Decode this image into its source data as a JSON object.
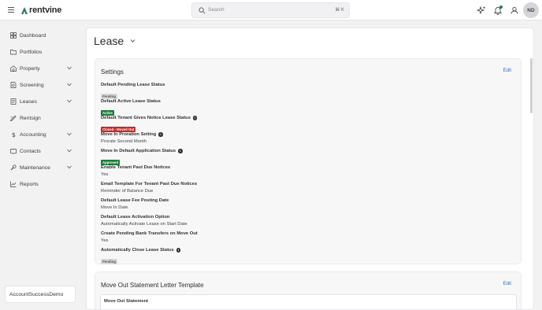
{
  "header": {
    "logo_text": "rentvine",
    "search_placeholder": "Search",
    "search_shortcut": "⌘ K",
    "avatar_initials": "ND",
    "brand_color": "#1f7a63"
  },
  "sidebar": {
    "items": [
      {
        "label": "Dashboard",
        "icon": "dashboard-icon"
      },
      {
        "label": "Portfolios",
        "icon": "folder-icon"
      },
      {
        "label": "Property",
        "icon": "building-icon"
      },
      {
        "label": "Screening",
        "icon": "screening-icon"
      },
      {
        "label": "Leases",
        "icon": "lease-icon"
      },
      {
        "label": "Rentsign",
        "icon": "sign-icon"
      },
      {
        "label": "Accounting",
        "icon": "dollar-icon"
      },
      {
        "label": "Contacts",
        "icon": "contacts-icon"
      },
      {
        "label": "Maintenance",
        "icon": "wrench-icon"
      },
      {
        "label": "Reports",
        "icon": "reports-icon"
      }
    ],
    "account_name": "AccountSuccessDemo"
  },
  "main": {
    "title": "Lease",
    "settings": {
      "title": "Settings",
      "edit_label": "Edit",
      "fields": [
        {
          "label": "Default Pending Lease Status",
          "badge": "Pending",
          "badge_color": "grey"
        },
        {
          "label": "Default Active Lease Status",
          "badge": "Active",
          "badge_color": "green"
        },
        {
          "label": "Default Tenant Gives Notice Lease Status",
          "badge": "Closed - Moved Out",
          "badge_color": "red",
          "info": true
        },
        {
          "label": "Move In Proration Setting",
          "value": "Prorate Second Month",
          "info": true
        },
        {
          "label": "Move In Default Application Status",
          "badge": "Approved",
          "badge_color": "green",
          "info": true
        },
        {
          "label": "Enable Tenant Past Due Notices",
          "value": "Yes"
        },
        {
          "label": "Email Template For Tenant Past Due Notices",
          "value": "Reminder of Balance Due"
        },
        {
          "label": "Default Lease Fee Posting Date",
          "value": "Move In Date"
        },
        {
          "label": "Default Lease Activation Option",
          "value": "Automatically Activate Lease on Start Date"
        },
        {
          "label": "Create Pending Bank Transfers on Move Out",
          "value": "Yes"
        },
        {
          "label": "Automatically Close Lease Status",
          "badge": "Pending",
          "badge_color": "grey",
          "info": true
        }
      ]
    },
    "move_out": {
      "title": "Move Out Statement Letter Template",
      "edit_label": "Edit",
      "inner_label": "Move Out Statement"
    }
  }
}
